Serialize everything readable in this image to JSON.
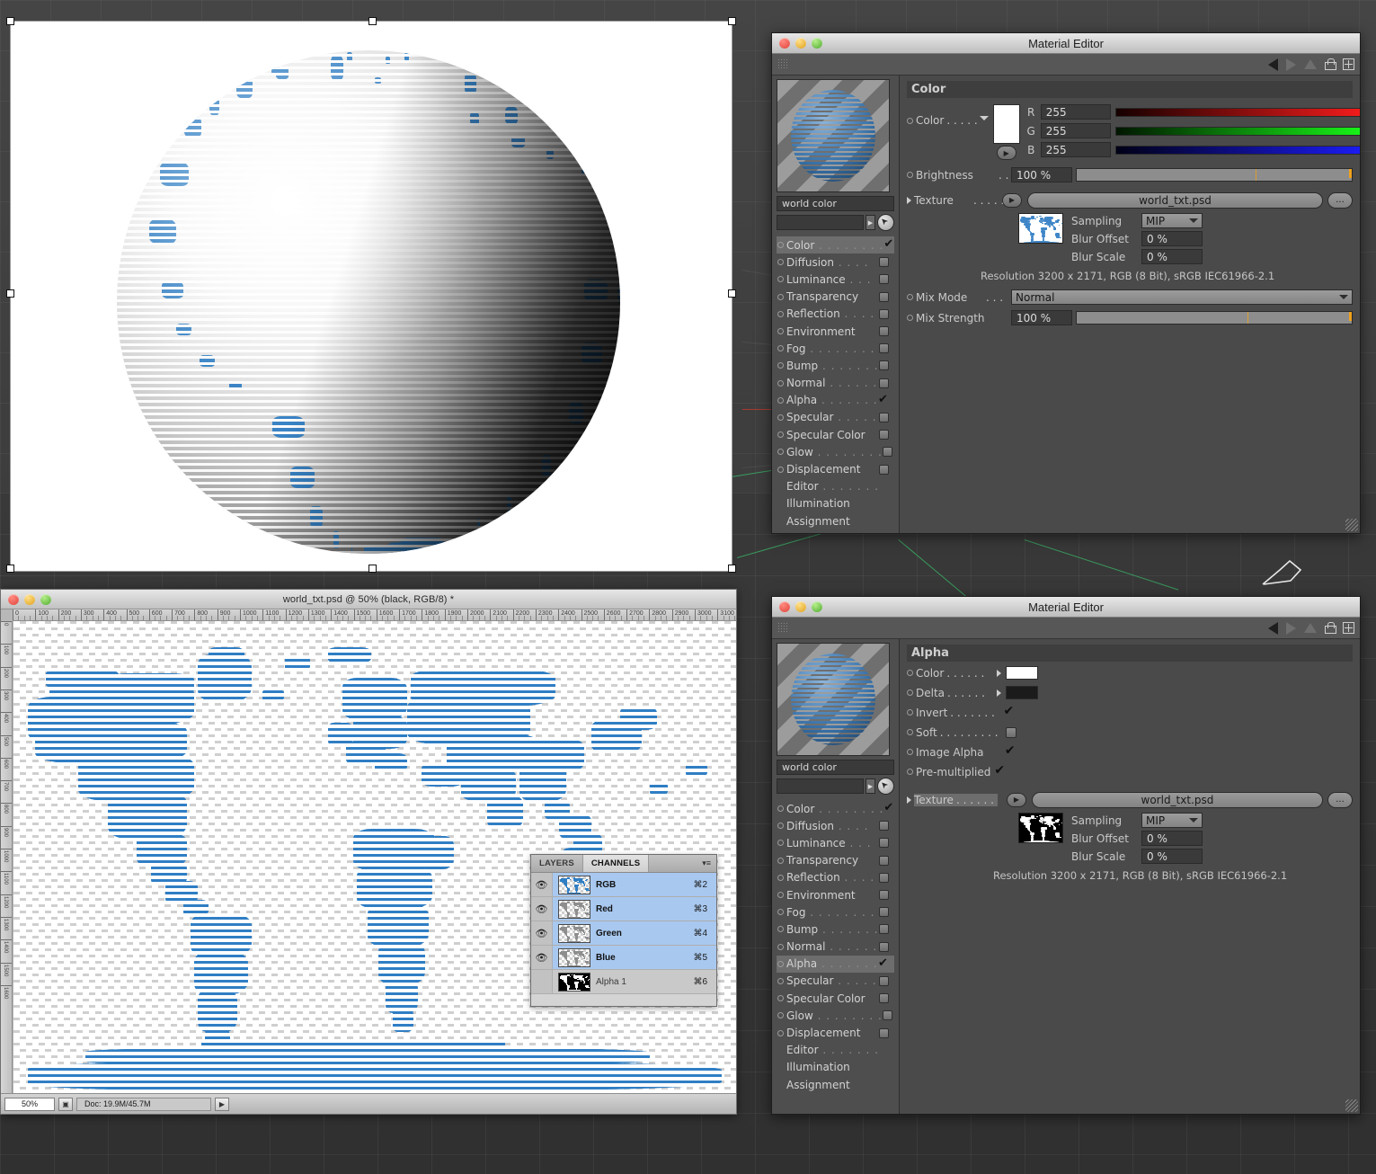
{
  "app": {
    "viewport_name": "cinema4d-viewport"
  },
  "render_window": {
    "name": "render-preview",
    "subject": "striped-blue-world-globe"
  },
  "photoshop": {
    "title": "world_txt.psd @ 50% (black, RGB/8) *",
    "ruler_h_labels": [
      "0",
      "100",
      "200",
      "300",
      "400",
      "500",
      "600",
      "700",
      "800",
      "900",
      "1000",
      "1100",
      "1200",
      "1300",
      "1400",
      "1500",
      "1600",
      "1700",
      "1800",
      "1900",
      "2000",
      "2100",
      "2200",
      "2300",
      "2400",
      "2500",
      "2600",
      "2700",
      "2800",
      "2900",
      "3000",
      "3100"
    ],
    "ruler_v_labels": [
      "0",
      "100",
      "200",
      "300",
      "400",
      "500",
      "600",
      "700",
      "800",
      "900",
      "1000",
      "1100",
      "1200",
      "1300",
      "1400",
      "1500",
      "1600"
    ],
    "statusbar": {
      "zoom": "50%",
      "doc": "Doc: 19.9M/45.7M",
      "arrow": "▶"
    },
    "channels_palette": {
      "tabs": [
        {
          "label": "LAYERS",
          "active": false
        },
        {
          "label": "CHANNELS",
          "active": true
        }
      ],
      "menu_icon": "panel-menu-icon",
      "rows": [
        {
          "name": "RGB",
          "shortcut": "⌘2",
          "visible": true,
          "thumb": "rgb"
        },
        {
          "name": "Red",
          "shortcut": "⌘3",
          "visible": true,
          "thumb": "gray"
        },
        {
          "name": "Green",
          "shortcut": "⌘4",
          "visible": true,
          "thumb": "gray"
        },
        {
          "name": "Blue",
          "shortcut": "⌘5",
          "visible": true,
          "thumb": "gray"
        },
        {
          "name": "Alpha 1",
          "shortcut": "⌘6",
          "visible": false,
          "thumb": "alpha"
        }
      ]
    }
  },
  "material_editor_color": {
    "title": "Material Editor",
    "material_name": "world color",
    "search_placeholder": "",
    "section_title": "Color",
    "channels": [
      {
        "label": "Color",
        "dots": ". . . . . . . .",
        "state": "checked",
        "selected": true
      },
      {
        "label": "Diffusion",
        "dots": ". . . .",
        "state": "box",
        "selected": false
      },
      {
        "label": "Luminance",
        "dots": ". . .",
        "state": "box",
        "selected": false
      },
      {
        "label": "Transparency",
        "dots": "",
        "state": "box",
        "selected": false
      },
      {
        "label": "Reflection",
        "dots": ". . . .",
        "state": "box",
        "selected": false
      },
      {
        "label": "Environment",
        "dots": "",
        "state": "box",
        "selected": false
      },
      {
        "label": "Fog",
        "dots": ". . . . . . . .",
        "state": "box",
        "selected": false
      },
      {
        "label": "Bump",
        "dots": ". . . . . . .",
        "state": "box",
        "selected": false
      },
      {
        "label": "Normal",
        "dots": ". . . . . .",
        "state": "box",
        "selected": false
      },
      {
        "label": "Alpha",
        "dots": ". . . . . . .",
        "state": "checked",
        "selected": false
      },
      {
        "label": "Specular",
        "dots": ". . . . .",
        "state": "box",
        "selected": false
      },
      {
        "label": "Specular Color",
        "dots": "",
        "state": "box",
        "selected": false
      },
      {
        "label": "Glow",
        "dots": ". . . . . . . .",
        "state": "box",
        "selected": false
      },
      {
        "label": "Displacement",
        "dots": "",
        "state": "box",
        "selected": false
      },
      {
        "label": "Editor",
        "dots": ". . . . . . .",
        "state": "none",
        "selected": false
      },
      {
        "label": "Illumination",
        "dots": "",
        "state": "none",
        "selected": false
      },
      {
        "label": "Assignment",
        "dots": "",
        "state": "none",
        "selected": false
      }
    ],
    "color_row": {
      "label": "Color",
      "dots": ". . . . ."
    },
    "rgb": [
      {
        "letter": "R",
        "value": "255"
      },
      {
        "letter": "G",
        "value": "255"
      },
      {
        "letter": "B",
        "value": "255"
      }
    ],
    "brightness": {
      "label": "Brightness",
      "dots": ". .",
      "value": "100 %"
    },
    "texture": {
      "label": "Texture",
      "dots": ". . . . .",
      "file": "world_txt.psd",
      "browse": "..."
    },
    "sampling": {
      "label": "Sampling",
      "value": "MIP"
    },
    "blur_offset": {
      "label": "Blur Offset",
      "value": "0 %"
    },
    "blur_scale": {
      "label": "Blur Scale",
      "value": "0 %"
    },
    "resolution": "Resolution 3200 x 2171, RGB (8 Bit), sRGB IEC61966-2.1",
    "mix_mode": {
      "label": "Mix Mode",
      "dots": ". . .",
      "value": "Normal"
    },
    "mix_strength": {
      "label": "Mix Strength",
      "value": "100 %"
    }
  },
  "material_editor_alpha": {
    "title": "Material Editor",
    "material_name": "world color",
    "section_title": "Alpha",
    "channels": [
      {
        "label": "Color",
        "dots": ". . . . . . . .",
        "state": "checked",
        "selected": false
      },
      {
        "label": "Diffusion",
        "dots": ". . . .",
        "state": "box",
        "selected": false
      },
      {
        "label": "Luminance",
        "dots": ". . .",
        "state": "box",
        "selected": false
      },
      {
        "label": "Transparency",
        "dots": "",
        "state": "box",
        "selected": false
      },
      {
        "label": "Reflection",
        "dots": ". . . .",
        "state": "box",
        "selected": false
      },
      {
        "label": "Environment",
        "dots": "",
        "state": "box",
        "selected": false
      },
      {
        "label": "Fog",
        "dots": ". . . . . . . .",
        "state": "box",
        "selected": false
      },
      {
        "label": "Bump",
        "dots": ". . . . . . .",
        "state": "box",
        "selected": false
      },
      {
        "label": "Normal",
        "dots": ". . . . . .",
        "state": "box",
        "selected": false
      },
      {
        "label": "Alpha",
        "dots": ". . . . . . .",
        "state": "checked",
        "selected": true
      },
      {
        "label": "Specular",
        "dots": ". . . . .",
        "state": "box",
        "selected": false
      },
      {
        "label": "Specular Color",
        "dots": "",
        "state": "box",
        "selected": false
      },
      {
        "label": "Glow",
        "dots": ". . . . . . . .",
        "state": "box",
        "selected": false
      },
      {
        "label": "Displacement",
        "dots": "",
        "state": "box",
        "selected": false
      },
      {
        "label": "Editor",
        "dots": ". . . . . . .",
        "state": "none",
        "selected": false
      },
      {
        "label": "Illumination",
        "dots": "",
        "state": "none",
        "selected": false
      },
      {
        "label": "Assignment",
        "dots": "",
        "state": "none",
        "selected": false
      }
    ],
    "props": [
      {
        "label": "Color",
        "dots": ". . . . . .",
        "kind": "swatch",
        "color": "#ffffff"
      },
      {
        "label": "Delta",
        "dots": ". . . . . .",
        "kind": "swatch",
        "color": "#1b1b1b"
      },
      {
        "label": "Invert",
        "dots": ". . . . . . .",
        "kind": "check",
        "value": true
      },
      {
        "label": "Soft",
        "dots": ". . . . . . . . .",
        "kind": "box",
        "value": false
      },
      {
        "label": "Image Alpha",
        "dots": "",
        "kind": "check",
        "value": true
      },
      {
        "label": "Pre-multiplied",
        "dots": "",
        "kind": "check",
        "value": true
      }
    ],
    "texture": {
      "label": "Texture",
      "dots": ". . . . . .",
      "file": "world_txt.psd",
      "browse": "..."
    },
    "sampling": {
      "label": "Sampling",
      "value": "MIP"
    },
    "blur_offset": {
      "label": "Blur Offset",
      "value": "0 %"
    },
    "blur_scale": {
      "label": "Blur Scale",
      "value": "0 %"
    },
    "resolution": "Resolution 3200 x 2171, RGB (8 Bit), sRGB IEC61966-2.1"
  },
  "colors": {
    "land_blue": "#2f7ec4",
    "panel_bg": "#4a4a4a",
    "slider_red": "#ff1d1d",
    "slider_green": "#19ff19",
    "slider_blue": "#1d1dff",
    "accent_orange": "#f0a21c"
  }
}
